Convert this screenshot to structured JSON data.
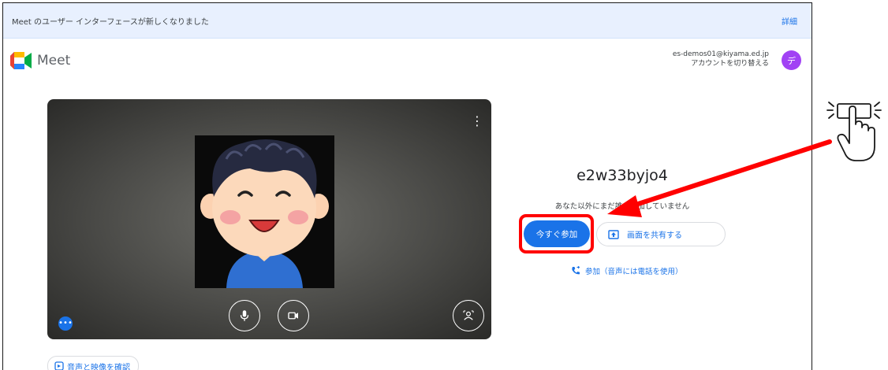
{
  "banner": {
    "text": "Meet のユーザー インターフェースが新しくなりました",
    "link": "詳細"
  },
  "app": {
    "name": "Meet"
  },
  "account": {
    "email": "es-demos01@kiyama.ed.jp",
    "switch": "アカウントを切り替える",
    "avatar_initial": "デ"
  },
  "preview": {
    "options_icon": "more-vert-icon",
    "more_icon": "more-horiz-icon"
  },
  "check_av": {
    "label": "音声と映像を確認"
  },
  "meeting": {
    "code": "e2w33byjo4",
    "status": "あなた以外にまだ誰も参加していません",
    "join_label": "今すぐ参加",
    "present_label": "画面を共有する",
    "phone_join_label": "参加（音声には電話を使用）"
  },
  "colors": {
    "accent": "#1a73e8",
    "highlight": "#ff0000",
    "banner_bg": "#e8f0fe",
    "avatar_bg": "#a142f4"
  }
}
